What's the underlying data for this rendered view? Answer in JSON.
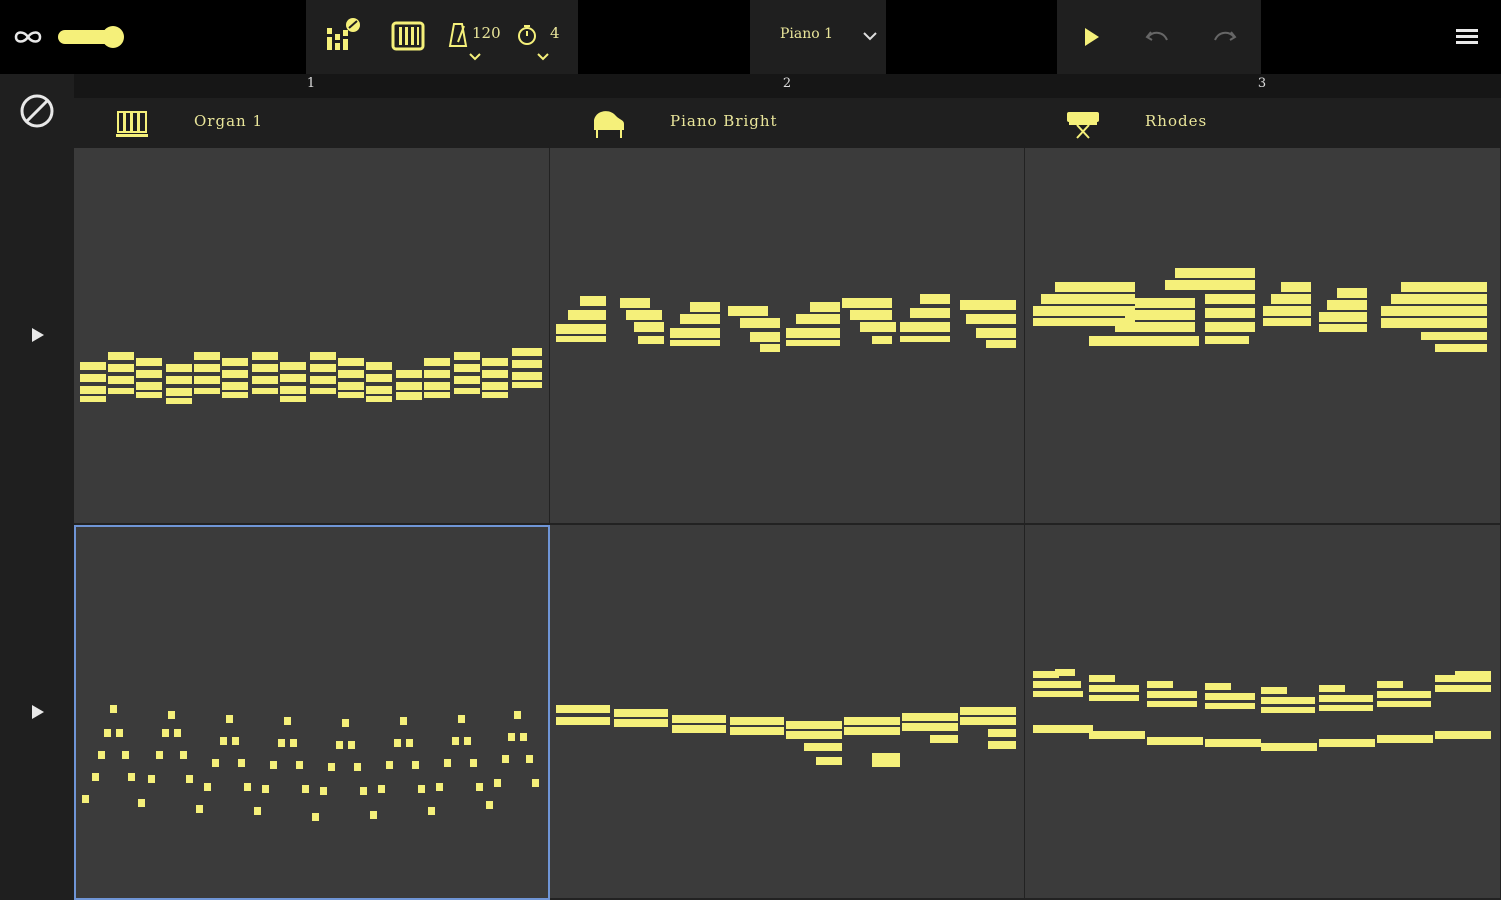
{
  "toolbar": {
    "loop_icon": "infinity-icon",
    "volume_level": 0.85,
    "mixer_icon": "mixer-icon",
    "keyboard_icon": "piano-keyboard-icon",
    "tempo_value": "120",
    "timer_value": "4",
    "instrument_name": "Piano 1",
    "colors": {
      "accent": "#f5f07a",
      "bg": "#000000",
      "panel": "#1f1f1f",
      "cell": "#3b3b3b",
      "selection": "#6f95d6"
    }
  },
  "columns": [
    {
      "number": "1",
      "track_name": "Organ 1",
      "icon": "organ-icon"
    },
    {
      "number": "2",
      "track_name": "Piano Bright",
      "icon": "grand-piano-icon"
    },
    {
      "number": "3",
      "track_name": "Rhodes",
      "icon": "rhodes-icon"
    }
  ],
  "rows": [
    {
      "play_icon": "play-icon"
    },
    {
      "play_icon": "play-icon"
    }
  ],
  "selected_cell": {
    "row": 2,
    "column": 1
  }
}
